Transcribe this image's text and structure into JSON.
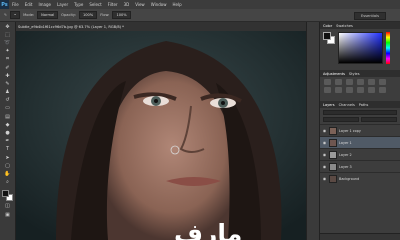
{
  "app": {
    "logo": "Ps"
  },
  "menu": [
    "File",
    "Edit",
    "Image",
    "Layer",
    "Type",
    "Select",
    "Filter",
    "3D",
    "View",
    "Window",
    "Help"
  ],
  "options": {
    "mode_label": "Mode:",
    "mode_value": "Normal",
    "opacity_label": "Opacity:",
    "opacity_value": "100%",
    "flow_label": "Flow:",
    "flow_value": "100%",
    "workspace": "Essentials"
  },
  "document_tab": "Subtle_e9b4b1f61cc96d7b.jpg @ 63.7% (Layer 1, RGB/8) *",
  "panels": {
    "top_tabs": [
      "Color",
      "Swatches"
    ],
    "mid_tabs": [
      "Adjustments",
      "Styles"
    ],
    "layer_tabs": [
      "Layers",
      "Channels",
      "Paths"
    ],
    "layers": [
      "Layer 1 copy",
      "Layer 1",
      "Layer 2",
      "Layer 3",
      "Background"
    ]
  },
  "watermark": "مارف"
}
